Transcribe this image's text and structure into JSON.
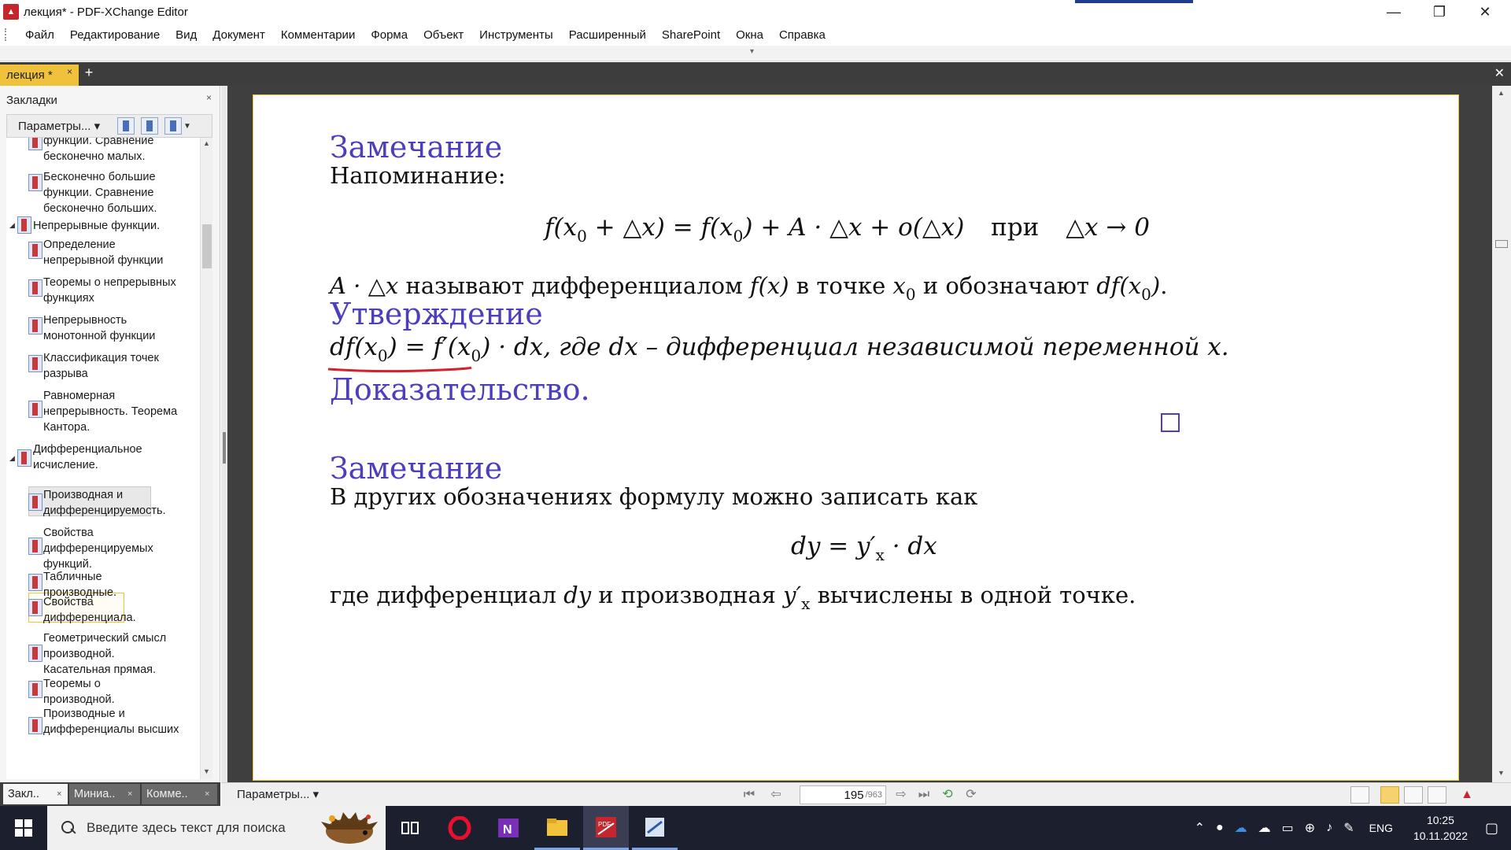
{
  "window": {
    "title": "лекция* - PDF-XChange Editor",
    "minimize": "—",
    "restore": "❐",
    "close": "✕"
  },
  "menu": [
    "Файл",
    "Редактирование",
    "Вид",
    "Документ",
    "Комментарии",
    "Форма",
    "Объект",
    "Инструменты",
    "Расширенный",
    "SharePoint",
    "Окна",
    "Справка"
  ],
  "tabs": {
    "doc_tab": "лекция *",
    "close": "×",
    "new_tab": "+",
    "strip_close": "✕"
  },
  "bookmarks_panel": {
    "title": "Закладки",
    "close": "×",
    "options": "Параметры...",
    "items": [
      {
        "label": "функции. Сравнение бесконечно малых.",
        "level": 1
      },
      {
        "label": "Бесконечно большие функции. Сравнение бесконечно больших.",
        "level": 1
      },
      {
        "label": "Непрерывные функции.",
        "level": 0,
        "expanded": true
      },
      {
        "label": "Определение непрерывной функции",
        "level": 1
      },
      {
        "label": "Теоремы о непрерывных функциях",
        "level": 1
      },
      {
        "label": "Непрерывность монотонной функции",
        "level": 1
      },
      {
        "label": "Классификация точек разрыва",
        "level": 1
      },
      {
        "label": "Равномерная непрерывность. Теорема Кантора.",
        "level": 1
      },
      {
        "label": "Дифференциальное исчисление.",
        "level": 0,
        "expanded": true
      },
      {
        "label": "Производная и дифференцируемость.",
        "level": 1,
        "selected": true
      },
      {
        "label": "Свойства дифференцируемых функций.",
        "level": 1
      },
      {
        "label": "Табличные производные.",
        "level": 1
      },
      {
        "label": "Свойства дифференциала.",
        "level": 1,
        "current": true
      },
      {
        "label": "Геометрический смысл производной. Касательная прямая.",
        "level": 1
      },
      {
        "label": "Теоремы о производной.",
        "level": 1
      },
      {
        "label": "Производные и дифференциалы высших",
        "level": 1
      }
    ],
    "bottom_tabs": [
      {
        "label": "Закл..",
        "active": true
      },
      {
        "label": "Миниа..",
        "active": false
      },
      {
        "label": "Комме..",
        "active": false
      }
    ]
  },
  "page": {
    "remark1_heading": "Замечание",
    "reminder": "Напоминание:",
    "formula1": {
      "lhs": "f(x",
      "lhs_sub": "0",
      "lhs_rest": " + △x) = f(x",
      "rhs_sub": "0",
      "rhs_rest": ") + A · △x + o(△x)",
      "word": "при",
      "limit": "△x → 0"
    },
    "definition_line": {
      "math1": "A · △x",
      "t1": " называют дифференциалом ",
      "math2": "f(x)",
      "t2": " в точке ",
      "math3": "x",
      "math3_sub": "0",
      "t3": " и обозначают ",
      "math4": "df(x",
      "math4_sub": "0",
      "math4_end": ")",
      "t4": "."
    },
    "statement_heading": "Утверждение",
    "statement_line": {
      "p1": "df(x",
      "p1_sub": "0",
      "p2": ") = f′(x",
      "p2_sub": "0",
      "p3": ") · dx, где dx – дифференциал независимой переменной x."
    },
    "proof_heading": "Доказательство.",
    "remark2_heading": "Замечание",
    "remark2_text": "В других обозначениях формулу можно записать как",
    "formula2": {
      "a": "dy = y′",
      "sub": "x",
      "b": " · dx"
    },
    "last_line": {
      "t1": "где дифференциал ",
      "m1": "dy",
      "t2": " и производная ",
      "m2": "y′",
      "m2_sub": "x",
      "t3": " вычислены в одной точке."
    }
  },
  "statusbar": {
    "options": "Параметры...",
    "current_page": "195",
    "total_pages": "/963"
  },
  "taskbar": {
    "search_placeholder": "Введите здесь текст для поиска",
    "lang": "ENG",
    "time": "10:25",
    "date": "10.11.2022"
  },
  "colors": {
    "heading": "#4b3fbd",
    "accent_tab": "#f0c23c",
    "underline": "#d6202b"
  }
}
